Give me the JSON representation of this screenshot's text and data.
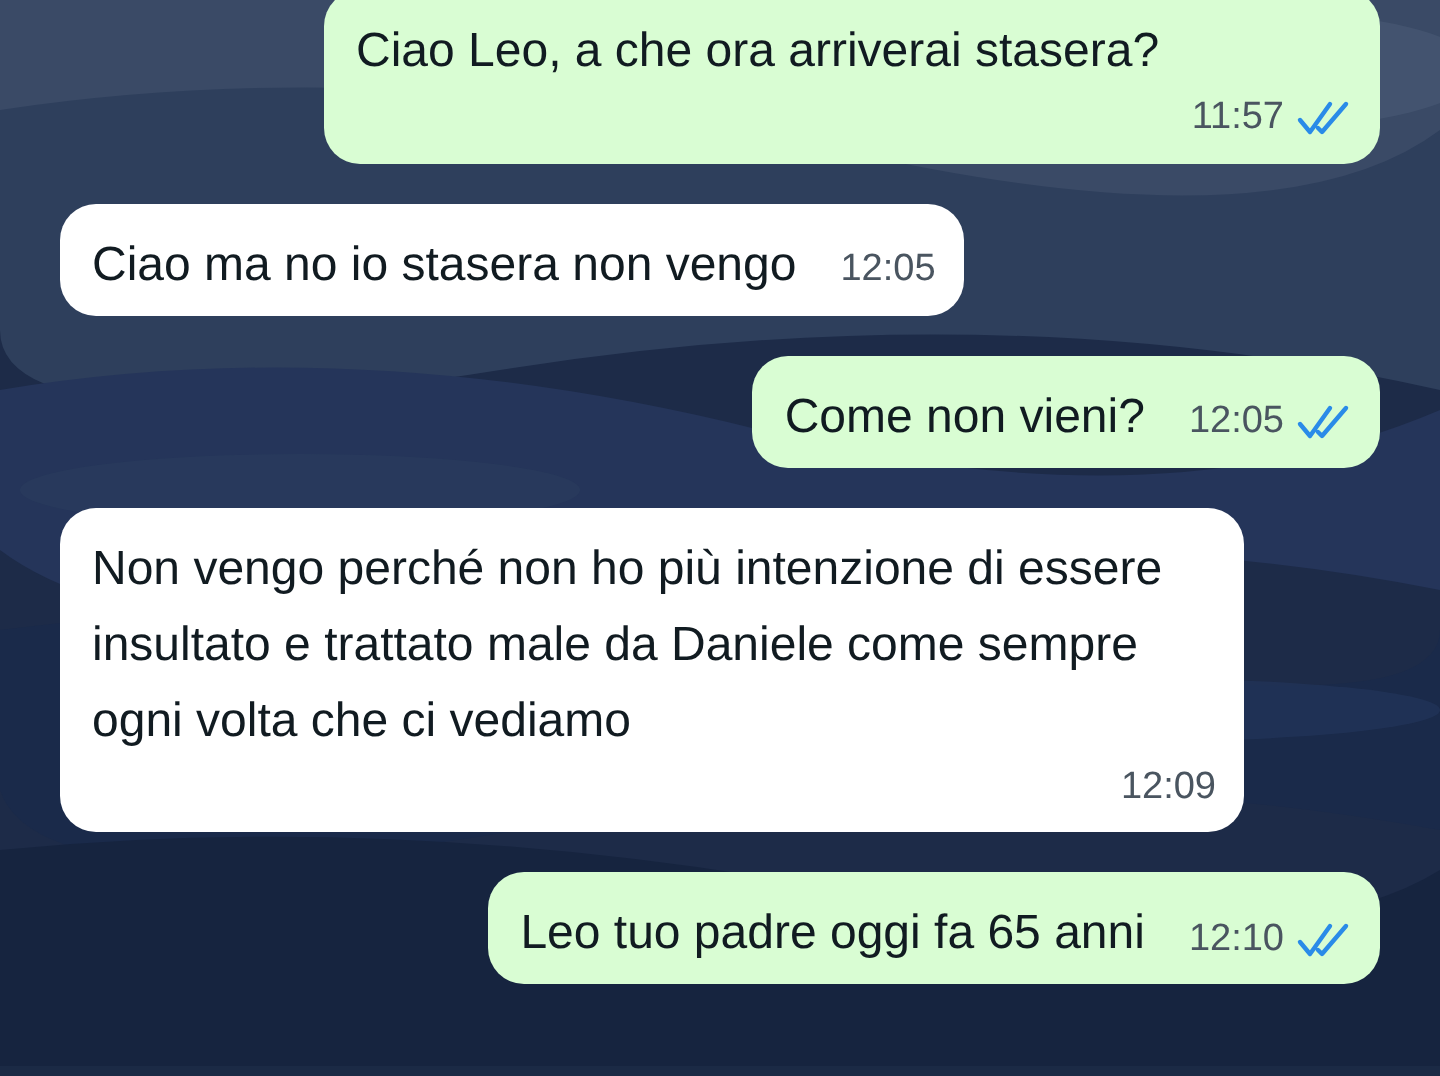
{
  "messages": [
    {
      "kind": "outgoing",
      "text": "Ciao Leo, a che ora arriverai stasera?",
      "time": "11:57",
      "read": true
    },
    {
      "kind": "incoming",
      "text": "Ciao ma no io stasera non vengo",
      "time": "12:05"
    },
    {
      "kind": "outgoing",
      "text": "Come non vieni?",
      "time": "12:05",
      "read": true
    },
    {
      "kind": "incoming",
      "text": "Non vengo perché non ho più intenzione di essere insultato e trattato male da Daniele come sempre ogni volta che ci vediamo",
      "time": "12:09"
    },
    {
      "kind": "outgoing",
      "text": "Leo tuo padre oggi fa 65 anni",
      "time": "12:10",
      "read": true
    }
  ]
}
